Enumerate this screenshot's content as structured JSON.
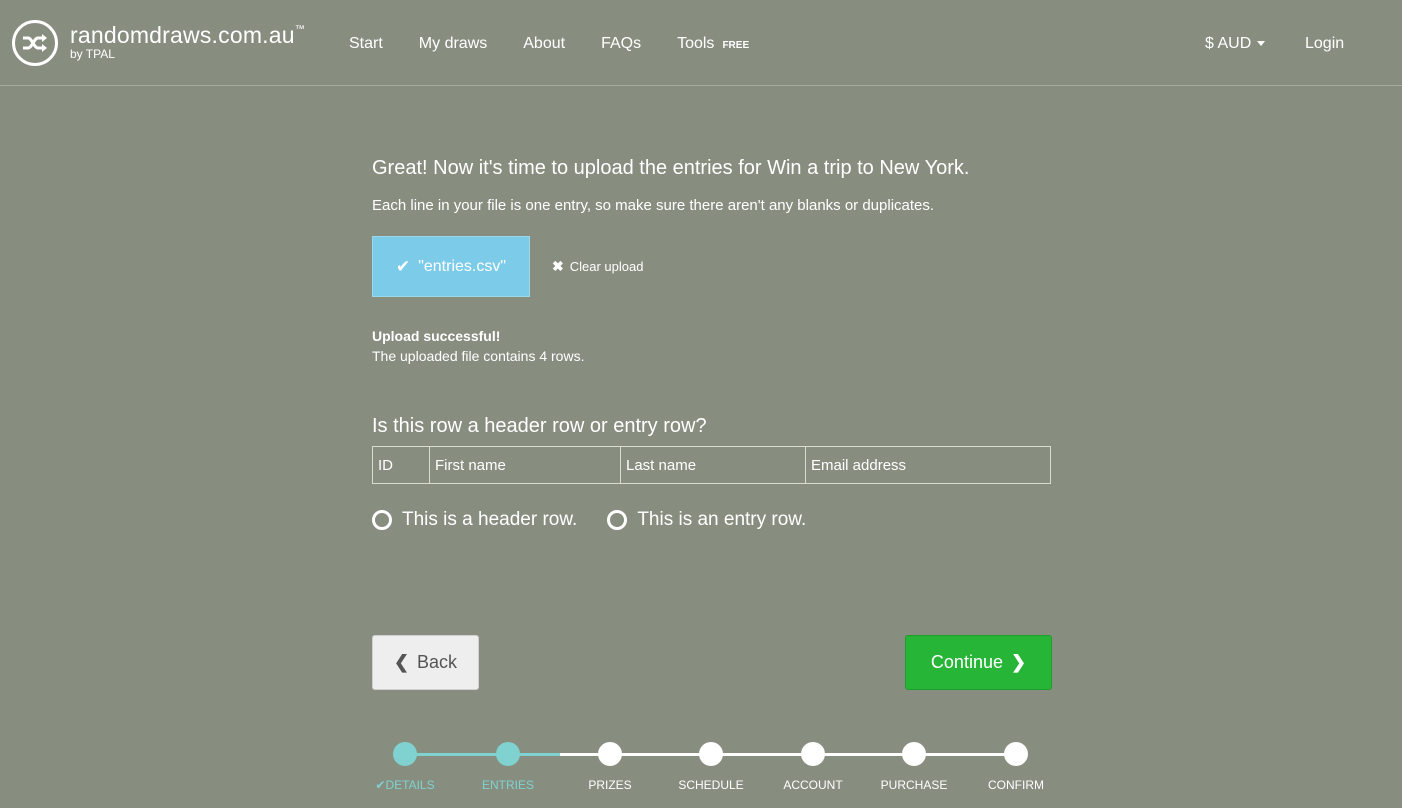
{
  "header": {
    "brand_name": "randomdraws.com.au",
    "brand_tm": "™",
    "brand_sub": "by TPAL",
    "nav": [
      {
        "label": "Start"
      },
      {
        "label": "My draws"
      },
      {
        "label": "About"
      },
      {
        "label": "FAQs"
      },
      {
        "label": "Tools",
        "badge": "FREE"
      }
    ],
    "currency": "$ AUD",
    "login": "Login"
  },
  "main": {
    "headline": "Great! Now it's time to upload the entries for Win a trip to New York.",
    "instructions": "Each line in your file is one entry, so make sure there aren't any blanks or duplicates.",
    "file_label": "\"entries.csv\"",
    "clear_label": "Clear upload",
    "success_title": "Upload successful!",
    "success_text": "The uploaded file contains 4 rows.",
    "question": "Is this row a header row or entry row?",
    "sample_row": [
      "ID",
      "First name",
      "Last name",
      "Email address"
    ],
    "radio_header": "This is a header row.",
    "radio_entry": "This is an entry row.",
    "back_label": "Back",
    "continue_label": "Continue"
  },
  "progress": {
    "steps": [
      {
        "label": "DETAILS",
        "status": "complete"
      },
      {
        "label": "ENTRIES",
        "status": "current"
      },
      {
        "label": "PRIZES",
        "status": "pending"
      },
      {
        "label": "SCHEDULE",
        "status": "pending"
      },
      {
        "label": "ACCOUNT",
        "status": "pending"
      },
      {
        "label": "PURCHASE",
        "status": "pending"
      },
      {
        "label": "CONFIRM",
        "status": "pending"
      }
    ],
    "done_color": "#7fd2cf"
  },
  "colors": {
    "background": "#878e80",
    "file_button": "#7ccbe9",
    "continue": "#27b538"
  }
}
